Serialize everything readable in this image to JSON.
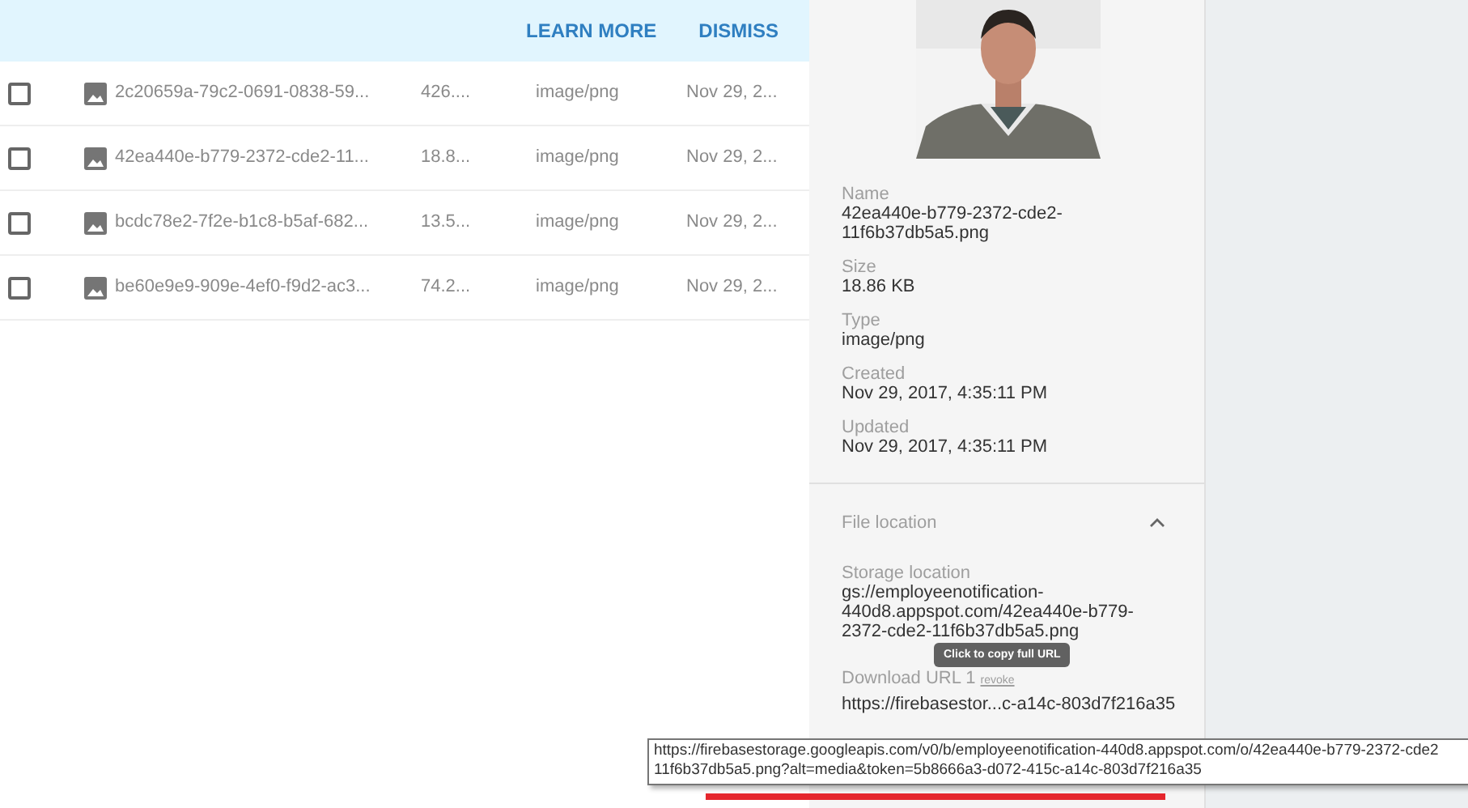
{
  "banner": {
    "actions": [
      "LEARN MORE",
      "DISMISS"
    ]
  },
  "files": [
    {
      "name": "2c20659a-79c2-0691-0838-59...",
      "size": "426....",
      "type": "image/png",
      "date": "Nov 29, 2...",
      "checked": false
    },
    {
      "name": "42ea440e-b779-2372-cde2-11...",
      "size": "18.8...",
      "type": "image/png",
      "date": "Nov 29, 2...",
      "checked": false
    },
    {
      "name": "bcdc78e2-7f2e-b1c8-b5af-682...",
      "size": "13.5...",
      "type": "image/png",
      "date": "Nov 29, 2...",
      "checked": false
    },
    {
      "name": "be60e9e9-909e-4ef0-f9d2-ac3...",
      "size": "74.2...",
      "type": "image/png",
      "date": "Nov 29, 2...",
      "checked": false
    }
  ],
  "details": {
    "fields": [
      {
        "label": "Name",
        "value": "42ea440e-b779-2372-cde2-11f6b37db5a5.png"
      },
      {
        "label": "Size",
        "value": "18.86 KB"
      },
      {
        "label": "Type",
        "value": "image/png"
      },
      {
        "label": "Created",
        "value": "Nov 29, 2017, 4:35:11 PM"
      },
      {
        "label": "Updated",
        "value": "Nov 29, 2017, 4:35:11 PM"
      }
    ],
    "file_location": {
      "title": "File location",
      "expanded": true,
      "storage_label": "Storage location",
      "storage_value": "gs://employeenotification-440d8.appspot.com/42ea440e-b779-2372-cde2-11f6b37db5a5.png",
      "download_label": "Download URL 1",
      "revoke": "revoke",
      "download_value": "https://firebasestor...c-a14c-803d7f216a35"
    }
  },
  "copy_tooltip": "Click to copy full URL",
  "url_tooltip": [
    "https://firebasestorage.googleapis.com/v0/b/employeenotification-440d8.appspot.com/o/42ea440e-b779-2372-cde2",
    "11f6b37db5a5.png?alt=media&token=5b8666a3-d072-415c-a14c-803d7f216a35"
  ]
}
